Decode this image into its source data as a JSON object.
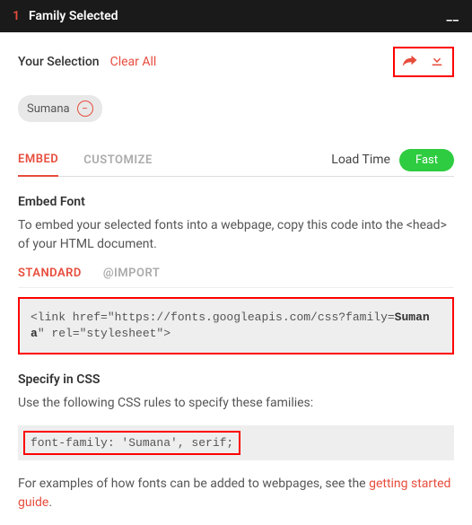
{
  "header": {
    "count": "1",
    "title": "Family Selected",
    "minimize": "__"
  },
  "selection": {
    "label": "Your Selection",
    "clear": "Clear All"
  },
  "chip": {
    "name": "Sumana"
  },
  "tabs": {
    "embed": "EMBED",
    "customize": "CUSTOMIZE"
  },
  "loadtime": {
    "label": "Load Time",
    "value": "Fast"
  },
  "embed": {
    "heading": "Embed Font",
    "desc": "To embed your selected fonts into a webpage, copy this code into the <head> of your HTML document.",
    "subtabs": {
      "standard": "STANDARD",
      "import": "@IMPORT"
    },
    "code_pre": "<link href=\"https://fonts.googleapis.com/css?family=",
    "code_family": "Sumana",
    "code_post": "\" rel=\"stylesheet\">"
  },
  "css": {
    "heading": "Specify in CSS",
    "desc": "Use the following CSS rules to specify these families:",
    "code": "font-family: 'Sumana', serif;"
  },
  "footer": {
    "text": "For examples of how fonts can be added to webpages, see the ",
    "link": "getting started guide",
    "period": "."
  }
}
